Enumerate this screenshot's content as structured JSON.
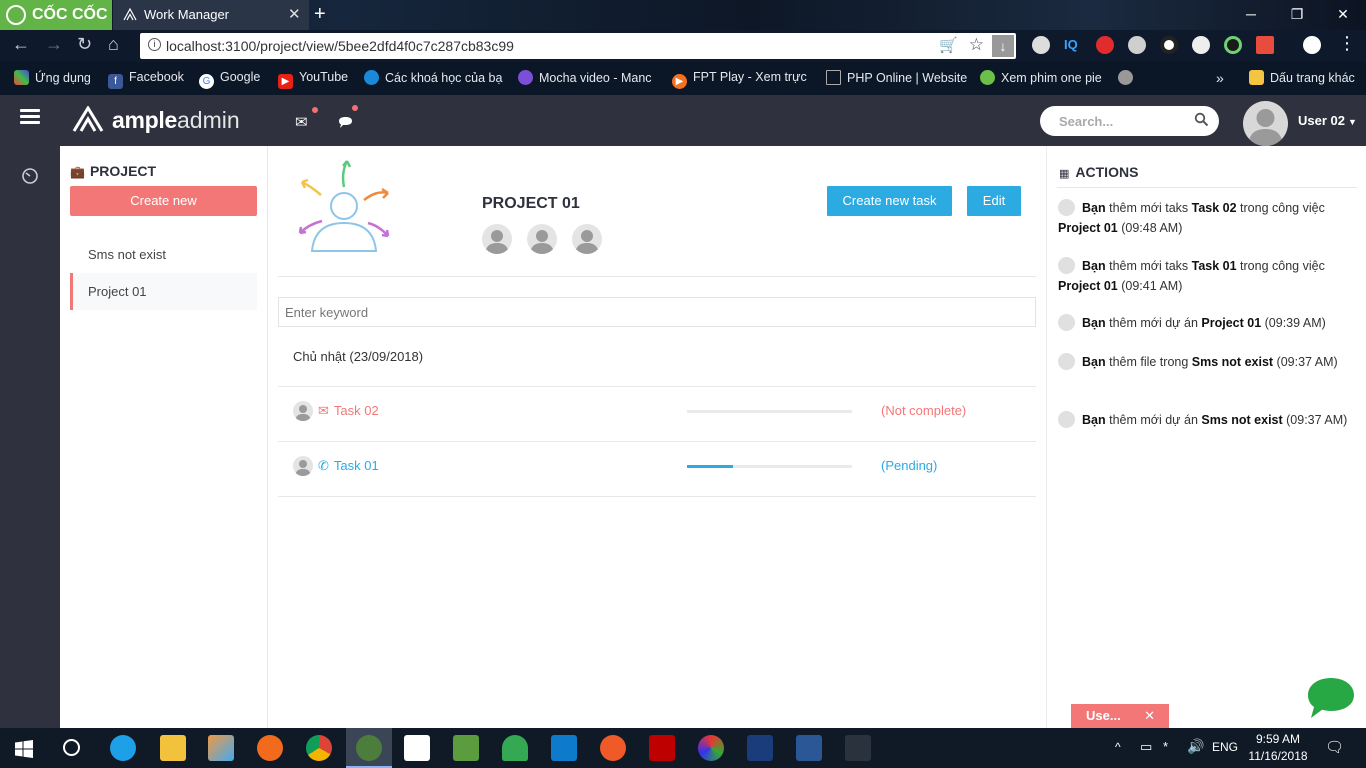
{
  "browser": {
    "brand": "CỐC CỐC",
    "tab_title": "Work Manager",
    "url": "localhost:3100/project/view/5bee2dfd4f0c7c287cb83c99",
    "bookmarks": [
      {
        "label": "Ứng dụng",
        "icon": "apps-grid-icon"
      },
      {
        "label": "Facebook",
        "icon": "facebook-icon"
      },
      {
        "label": "Google",
        "icon": "google-icon"
      },
      {
        "label": "YouTube",
        "icon": "youtube-icon"
      },
      {
        "label": "Các khoá học của bạ",
        "icon": "course-icon"
      },
      {
        "label": "Mocha video - Manc",
        "icon": "mocha-icon"
      },
      {
        "label": "FPT Play - Xem trực",
        "icon": "fpt-play-icon"
      },
      {
        "label": "PHP Online | Website",
        "icon": "page-icon"
      },
      {
        "label": "Xem phim one pie",
        "icon": "movie-icon"
      }
    ],
    "bookmarks_more": "»",
    "other_bookmarks": "Dấu trang khác"
  },
  "header": {
    "brand_bold": "ample",
    "brand_light": "admin",
    "search_placeholder": "Search...",
    "user_name": "User 02"
  },
  "sidebar": {
    "title": "PROJECT",
    "create_label": "Create new",
    "projects": [
      {
        "name": "Sms not exist",
        "active": false
      },
      {
        "name": "Project 01",
        "active": true
      }
    ]
  },
  "main": {
    "project_name": "PROJECT 01",
    "member_count": 3,
    "create_task_label": "Create new task",
    "edit_label": "Edit",
    "keyword_placeholder": "Enter keyword",
    "date_group": "Chủ nhật (23/09/2018)",
    "tasks": [
      {
        "name": "Task 02",
        "icon": "mail-icon",
        "progress": 0,
        "status": "(Not complete)",
        "color": "#f47777"
      },
      {
        "name": "Task 01",
        "icon": "phone-icon",
        "progress": 0.28,
        "status": "(Pending)",
        "color": "#2cabe3"
      }
    ]
  },
  "actions": {
    "title": "ACTIONS",
    "items": [
      {
        "pre": "Bạn",
        "mid": " thêm mới taks ",
        "target": "Task 02",
        "mid2": " trong công việc ",
        "target2": "Project 01",
        "time": " (09:48 AM)"
      },
      {
        "pre": "Bạn",
        "mid": " thêm mới taks ",
        "target": "Task 01",
        "mid2": " trong công việc ",
        "target2": "Project 01",
        "time": " (09:41 AM)"
      },
      {
        "pre": "Bạn",
        "mid": " thêm mới dự án ",
        "target": "Project 01",
        "mid2": "",
        "target2": "",
        "time": " (09:39 AM)"
      },
      {
        "pre": "Bạn",
        "mid": " thêm file trong ",
        "target": "Sms not exist",
        "mid2": "",
        "target2": "",
        "time": " (09:37 AM)"
      },
      {
        "pre": "Bạn",
        "mid": " thêm mới dự án ",
        "target": "Sms not exist",
        "mid2": "",
        "target2": "",
        "time": " (09:37 AM)"
      }
    ]
  },
  "floating": {
    "use_label": "Use..."
  },
  "taskbar": {
    "language": "ENG",
    "time": "9:59 AM",
    "date": "11/16/2018"
  },
  "colors": {
    "accent_red": "#f47777",
    "accent_blue": "#2cabe3",
    "header_dark": "#2f323e"
  }
}
